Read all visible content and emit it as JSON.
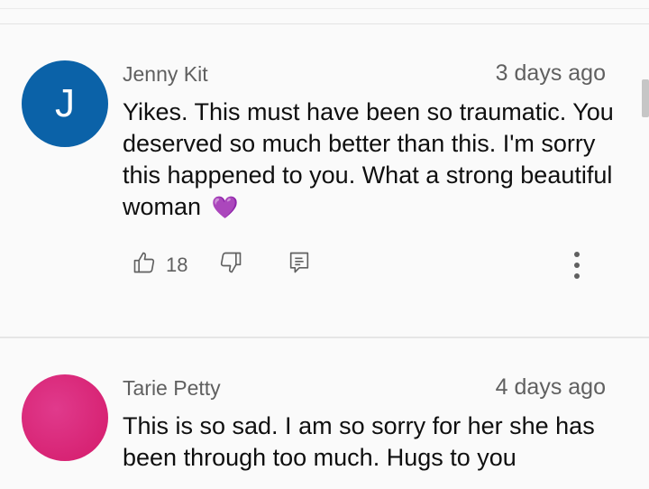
{
  "comments": [
    {
      "author": "Jenny Kit",
      "time": "3 days ago",
      "avatar_letter": "J",
      "avatar_color": "#0b62a8",
      "text": "Yikes. This must have been so traumatic. You deserved so much better than this. I'm sorry this happened to you. What a strong beautiful woman",
      "emoji": "💜",
      "likes": "18"
    },
    {
      "author": "Tarie Petty",
      "time": "4 days ago",
      "avatar_letter": "",
      "avatar_color": "#d81b70",
      "text": "This is so sad. I am so sorry for her she has been through too much. Hugs to you"
    }
  ],
  "icons": {
    "like": "thumbs-up-icon",
    "dislike": "thumbs-down-icon",
    "reply": "reply-icon",
    "more": "more-vert-icon"
  }
}
